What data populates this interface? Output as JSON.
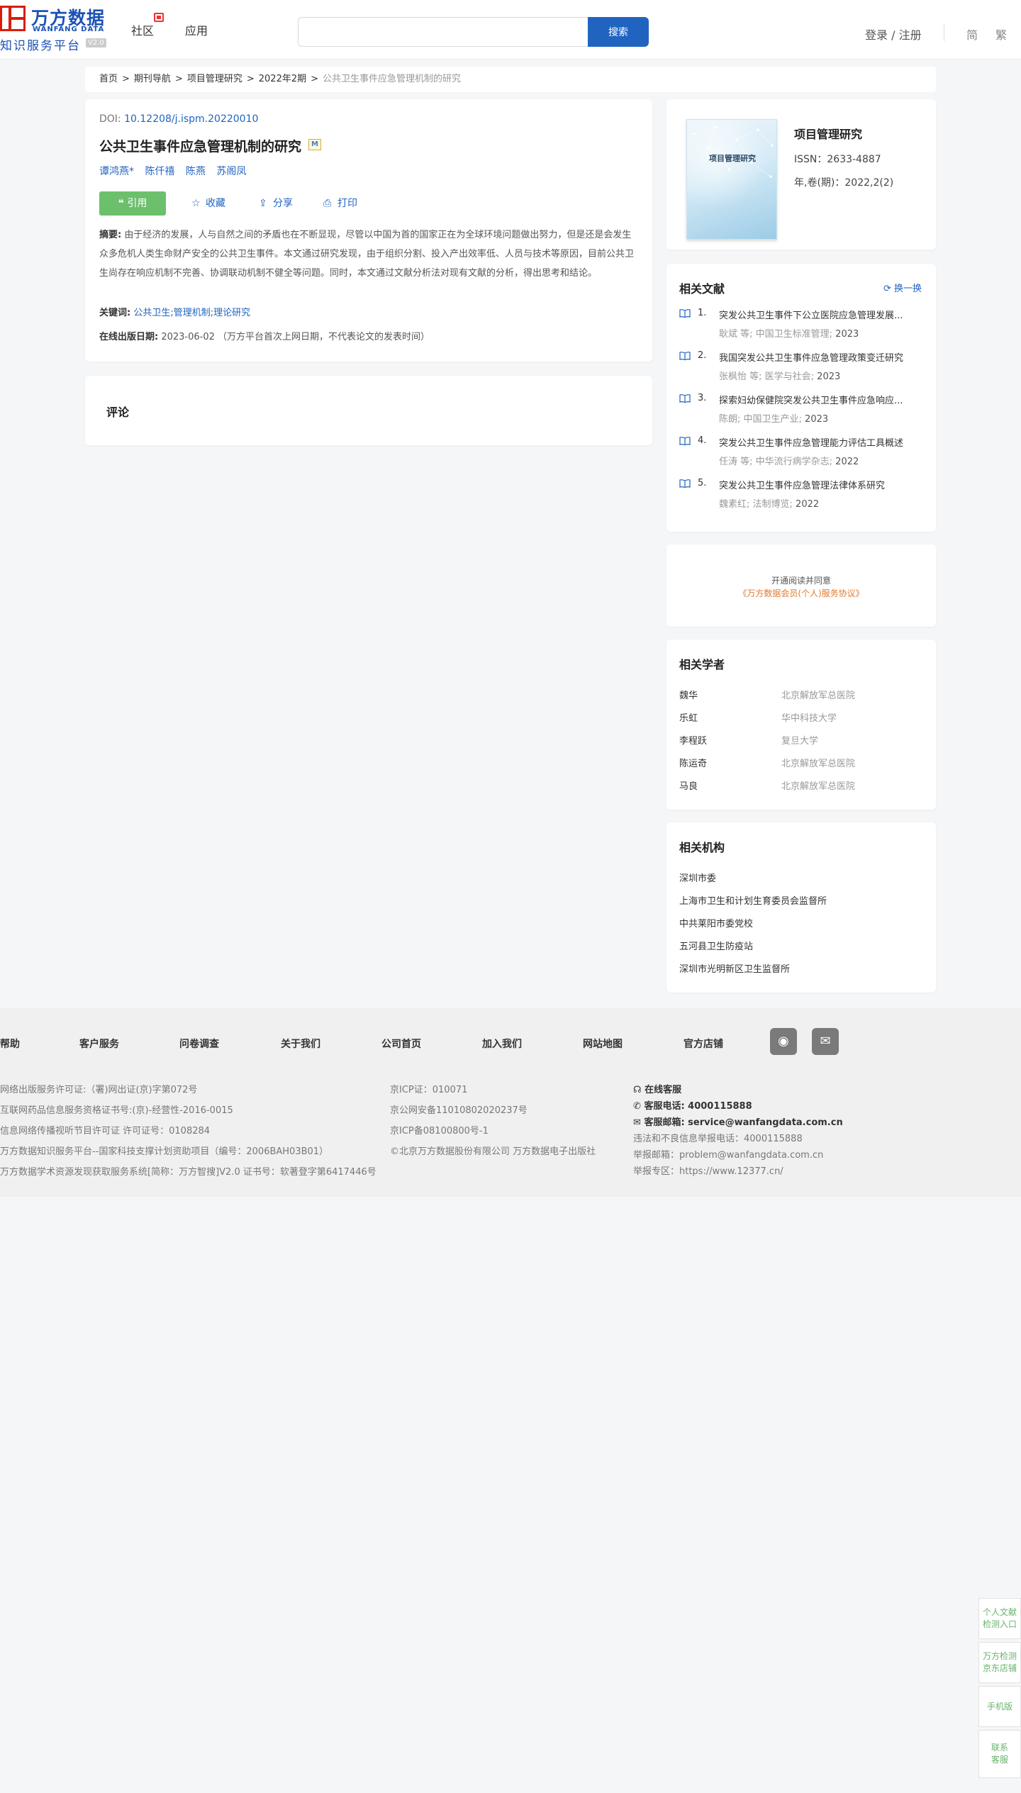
{
  "header": {
    "logo_cn": "万方数据",
    "logo_en": "WANFANG DATA",
    "logo_sub": "知识服务平台",
    "logo_version": "V2.0",
    "nav": [
      "社区",
      "应用"
    ],
    "search_placeholder": "",
    "search_button": "搜索",
    "login": "登录 / 注册",
    "lang_simplified": "简",
    "lang_traditional": "繁"
  },
  "breadcrumb": [
    "首页",
    "期刊导航",
    "项目管理研究",
    "2022年2期",
    "公共卫生事件应急管理机制的研究"
  ],
  "article": {
    "doi_label": "DOI:",
    "doi": "10.12208/j.ispm.20220010",
    "title": "公共卫生事件应急管理机制的研究",
    "m_badge": "M",
    "authors": [
      "谭鸿燕*",
      "陈仟禧",
      "陈燕",
      "苏阁凤"
    ],
    "actions": {
      "cite": "引用",
      "favorite": "收藏",
      "share": "分享",
      "print": "打印"
    },
    "abstract_label": "摘要:",
    "abstract": "由于经济的发展，人与自然之间的矛盾也在不断显现，尽管以中国为首的国家正在为全球环境问题做出努力，但是还是会发生众多危机人类生命财产安全的公共卫生事件。本文通过研究发现，由于组织分割、投入产出效率低、人员与技术等原因，目前公共卫生尚存在响应机制不完善、协调联动机制不健全等问题。同时，本文通过文献分析法对现有文献的分析，得出思考和结论。",
    "keywords_label": "关键词:",
    "keywords": [
      "公共卫生;",
      "管理机制;",
      "理论研究"
    ],
    "pubdate_label": "在线出版日期:",
    "pubdate": "2023-06-02",
    "pubdate_note": "（万方平台首次上网日期，不代表论文的发表时间）"
  },
  "comments": {
    "title": "评论"
  },
  "journal": {
    "cover_title": "项目管理研究",
    "name": "项目管理研究",
    "issn": "ISSN：2633-4887",
    "volume": "年,卷(期)：2022,2(2)"
  },
  "related_docs": {
    "title": "相关文献",
    "refresh": "换一换",
    "items": [
      {
        "num": "1.",
        "title": "突发公共卫生事件下公立医院应急管理发展...",
        "meta": "耿斌  等;  中国卫生标准管理;",
        "year": "2023"
      },
      {
        "num": "2.",
        "title": "我国突发公共卫生事件应急管理政策变迁研究",
        "meta": "张枫怡  等;  医学与社会;",
        "year": "2023"
      },
      {
        "num": "3.",
        "title": "探索妇幼保健院突发公共卫生事件应急响应...",
        "meta": "陈朗; 中国卫生产业;",
        "year": "2023"
      },
      {
        "num": "4.",
        "title": "突发公共卫生事件应急管理能力评估工具概述",
        "meta": "任涛  等;  中华流行病学杂志;",
        "year": "2022"
      },
      {
        "num": "5.",
        "title": "突发公共卫生事件应急管理法律体系研究",
        "meta": "魏素红; 法制博览;",
        "year": "2022"
      }
    ]
  },
  "agreement": {
    "line1": "开通阅读并同意",
    "line2": "《万方数据会员(个人)服务协议》"
  },
  "scholars": {
    "title": "相关学者",
    "items": [
      {
        "name": "魏华",
        "org": "北京解放军总医院"
      },
      {
        "name": "乐虹",
        "org": "华中科技大学"
      },
      {
        "name": "李程跃",
        "org": "复旦大学"
      },
      {
        "name": "陈运奇",
        "org": "北京解放军总医院"
      },
      {
        "name": "马良",
        "org": "北京解放军总医院"
      }
    ]
  },
  "institutions": {
    "title": "相关机构",
    "items": [
      "深圳市委",
      "上海市卫生和计划生育委员会监督所",
      "中共莱阳市委党校",
      "五河县卫生防疫站",
      "深圳市光明新区卫生监督所"
    ]
  },
  "footer": {
    "nav": [
      "帮助",
      "客户服务",
      "问卷调查",
      "关于我们",
      "公司首页",
      "加入我们",
      "网站地图",
      "官方店铺"
    ],
    "col1": [
      "网络出版服务许可证:（署)网出证(京)字第072号",
      "互联网药品信息服务资格证书号:(京)-经营性-2016-0015",
      "信息网络传播视听节目许可证 许可证号：0108284",
      "万方数据知识服务平台--国家科技支撑计划资助项目（编号：2006BAH03B01）",
      "万方数据学术资源发现获取服务系统[简称：万方智搜]V2.0 证书号：软著登字第6417446号"
    ],
    "col2": [
      "京ICP证：010071",
      "京公网安备11010802020237号",
      "京ICP备08100800号-1",
      "©北京万方数据股份有限公司 万方数据电子出版社"
    ],
    "online_service": "在线客服",
    "phone_label": "客服电话:",
    "phone": "4000115888",
    "email_label": "客服邮箱:",
    "email": "service@wanfangdata.com.cn",
    "report_phone": "违法和不良信息举报电话：4000115888",
    "report_email": "举报邮箱：problem@wanfangdata.com.cn",
    "report_zone": "举报专区：https://www.12377.cn/"
  },
  "side_buttons": [
    "个人文献检测入口",
    "万方检测京东店铺",
    "手机版",
    "联系客服"
  ]
}
